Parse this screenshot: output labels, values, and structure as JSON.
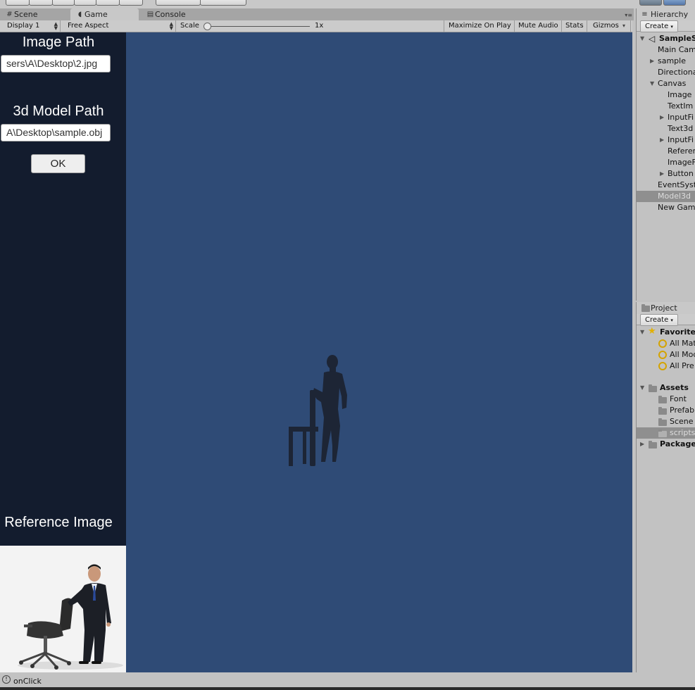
{
  "tabs": {
    "scene": "Scene",
    "game": "Game",
    "console": "Console"
  },
  "game_toolbar": {
    "display": "Display 1",
    "aspect": "Free Aspect",
    "scale_label": "Scale",
    "scale_value": "1x",
    "maximize": "Maximize On Play",
    "mute": "Mute Audio",
    "stats": "Stats",
    "gizmos": "Gizmos"
  },
  "game_ui": {
    "image_path_label": "Image Path",
    "image_path_value": "sers\\A\\Desktop\\2.jpg",
    "model_path_label": "3d Model Path",
    "model_path_value": "A\\Desktop\\sample.obj",
    "ok_button": "OK",
    "reference_label": "Reference Image"
  },
  "hierarchy": {
    "title": "Hierarchy",
    "create": "Create",
    "items": [
      {
        "label": "SampleS",
        "bold": true
      },
      {
        "label": "Main Cam"
      },
      {
        "label": "sample"
      },
      {
        "label": "Directiona"
      },
      {
        "label": "Canvas"
      },
      {
        "label": "Image"
      },
      {
        "label": "TextIm"
      },
      {
        "label": "InputFi"
      },
      {
        "label": "Text3d"
      },
      {
        "label": "InputFi"
      },
      {
        "label": "Referen"
      },
      {
        "label": "ImageF"
      },
      {
        "label": "Button"
      },
      {
        "label": "EventSyst"
      },
      {
        "label": "Model3d",
        "selected": true
      },
      {
        "label": "New Gam"
      }
    ]
  },
  "project": {
    "title": "Project",
    "create": "Create",
    "favorites": "Favorite",
    "fav_items": [
      "All Mat",
      "All Mod",
      "All Pre"
    ],
    "assets": "Assets",
    "asset_items": [
      "Font",
      "Prefab",
      "Scene",
      "scripts"
    ],
    "packages": "Package"
  },
  "status": {
    "text": "onClick"
  }
}
